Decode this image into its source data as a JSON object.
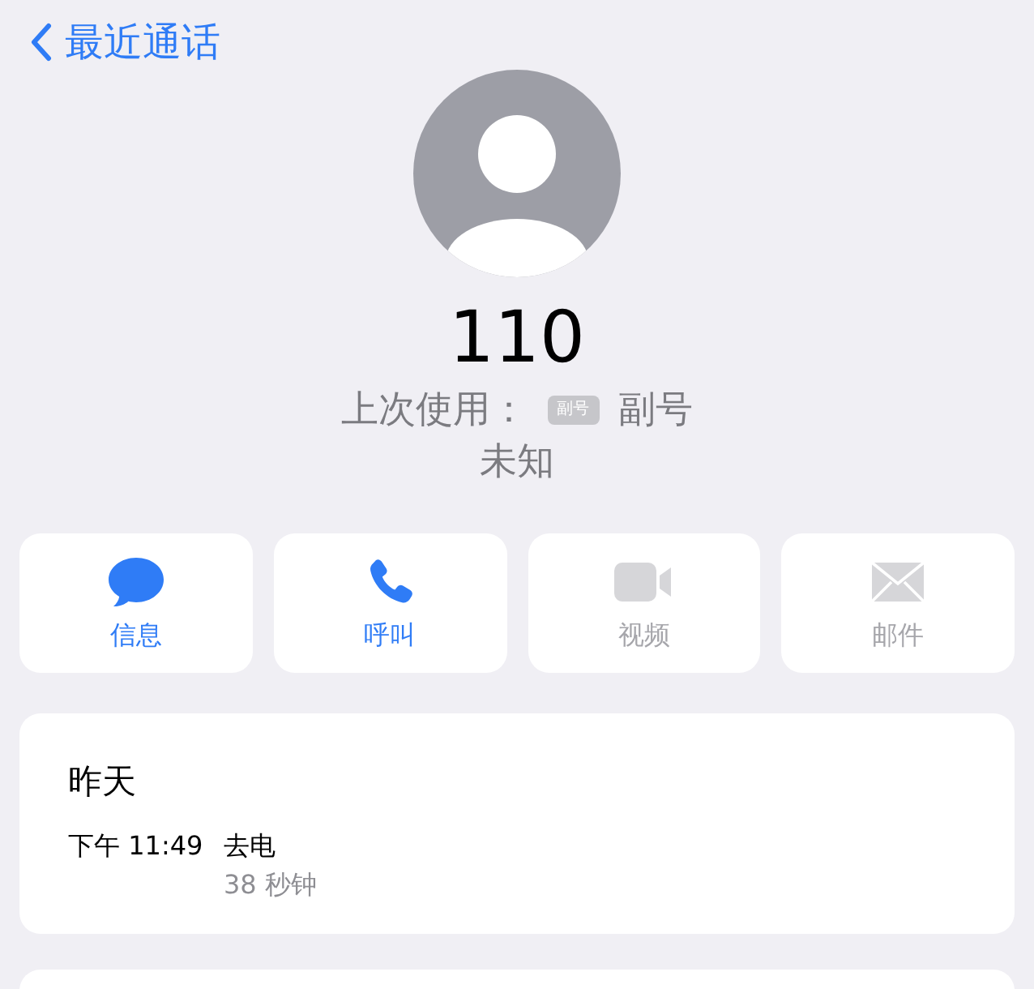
{
  "nav": {
    "back_label": "最近通话"
  },
  "contact": {
    "name": "110",
    "last_used_label": "上次使用：",
    "line_badge": "副号",
    "line_name": "副号",
    "subtitle": "未知"
  },
  "actions": [
    {
      "kind": "message",
      "label": "信息",
      "disabled": false
    },
    {
      "kind": "call",
      "label": "呼叫",
      "disabled": false
    },
    {
      "kind": "video",
      "label": "视频",
      "disabled": true
    },
    {
      "kind": "mail",
      "label": "邮件",
      "disabled": true
    }
  ],
  "call_history": {
    "date": "昨天",
    "calls": [
      {
        "time": "下午 11:49",
        "type": "去电",
        "duration": "38 秒钟"
      }
    ]
  }
}
